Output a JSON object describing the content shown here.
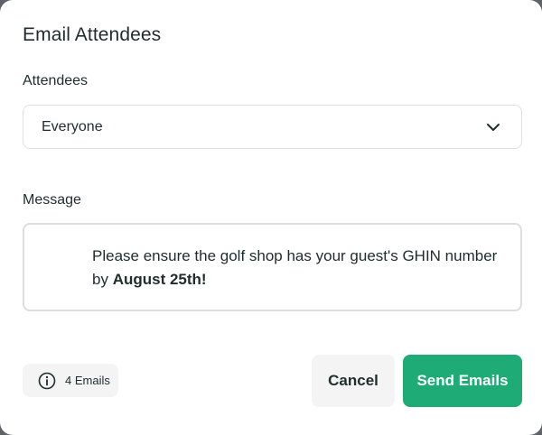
{
  "dialog": {
    "title": "Email Attendees"
  },
  "attendees": {
    "label": "Attendees",
    "selected": "Everyone",
    "icon": "chevron-down-icon"
  },
  "message": {
    "label": "Message",
    "text_before": "Please ensure the golf shop has your guest's GHIN number by ",
    "text_bold": "August 25th!"
  },
  "footer": {
    "count_icon": "info-icon",
    "count_text": "4 Emails",
    "cancel_label": "Cancel",
    "send_label": "Send Emails"
  },
  "colors": {
    "accent": "#1fab76",
    "text": "#1f2d2c",
    "muted_bg": "#f4f4f4",
    "border": "#dfe1e2"
  }
}
